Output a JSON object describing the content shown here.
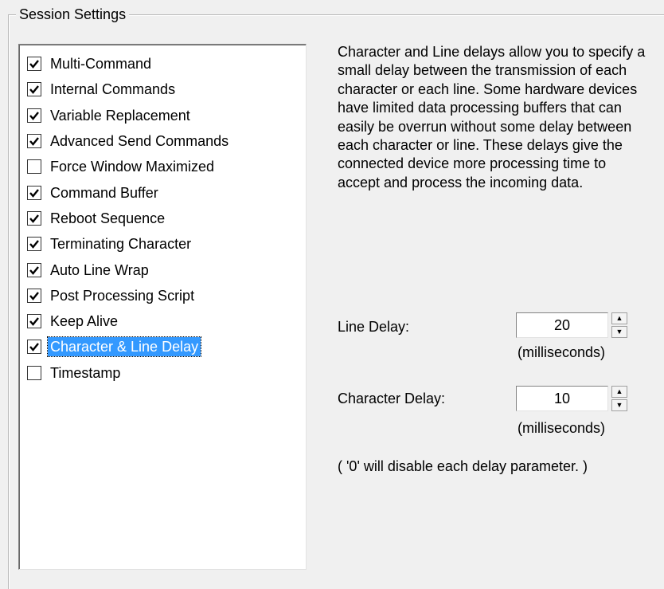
{
  "group": {
    "title": "Session Settings"
  },
  "options": [
    {
      "label": "Multi-Command",
      "checked": true,
      "selected": false
    },
    {
      "label": "Internal Commands",
      "checked": true,
      "selected": false
    },
    {
      "label": "Variable Replacement",
      "checked": true,
      "selected": false
    },
    {
      "label": "Advanced Send Commands",
      "checked": true,
      "selected": false
    },
    {
      "label": "Force Window Maximized",
      "checked": false,
      "selected": false
    },
    {
      "label": "Command Buffer",
      "checked": true,
      "selected": false
    },
    {
      "label": "Reboot Sequence",
      "checked": true,
      "selected": false
    },
    {
      "label": "Terminating Character",
      "checked": true,
      "selected": false
    },
    {
      "label": "Auto Line Wrap",
      "checked": true,
      "selected": false
    },
    {
      "label": "Post Processing Script",
      "checked": true,
      "selected": false
    },
    {
      "label": "Keep Alive",
      "checked": true,
      "selected": false
    },
    {
      "label": "Character & Line Delay",
      "checked": true,
      "selected": true
    },
    {
      "label": "Timestamp",
      "checked": false,
      "selected": false
    }
  ],
  "description": "Character and Line delays allow you to specify a small delay between the transmission of each character or each line.  Some hardware devices have limited data processing buffers that can easily be overrun without some delay between each character or line.  These delays give the connected device more processing time to accept and process the incoming data.",
  "line_delay": {
    "label": "Line Delay:",
    "value": "20",
    "unit": "(milliseconds)"
  },
  "character_delay": {
    "label": "Character Delay:",
    "value": "10",
    "unit": "(milliseconds)"
  },
  "footnote": "( '0' will disable each delay parameter. )",
  "icons": {
    "spin_up": "up-arrow-icon",
    "spin_down": "down-arrow-icon",
    "check": "checkmark-icon"
  }
}
